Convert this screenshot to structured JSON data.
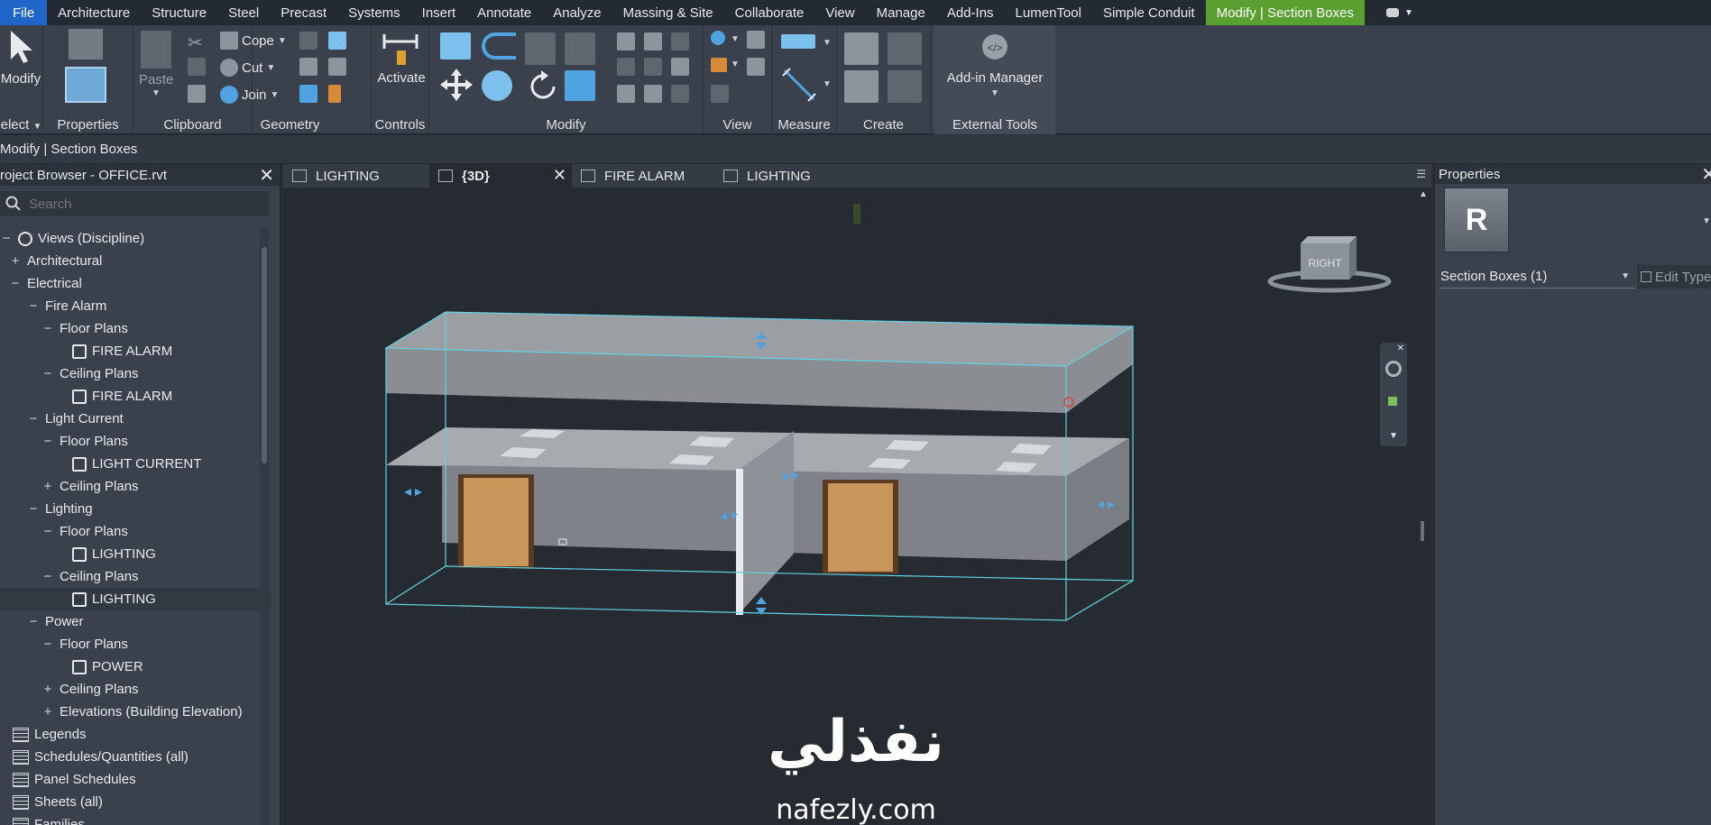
{
  "menu": {
    "items": [
      "File",
      "Architecture",
      "Structure",
      "Steel",
      "Precast",
      "Systems",
      "Insert",
      "Annotate",
      "Analyze",
      "Massing & Site",
      "Collaborate",
      "View",
      "Manage",
      "Add-Ins",
      "LumenTool",
      "Simple Conduit",
      "Modify | Section Boxes"
    ],
    "active_item": "Modify | Section Boxes",
    "accent_color": "#5aa031",
    "file_color": "#1f66c8"
  },
  "ribbon": {
    "modify_label": "Modify",
    "select_label": "elect",
    "properties_label": "Properties",
    "paste_label": "Paste",
    "clipboard_label": "Clipboard",
    "cope_label": "Cope",
    "cut_label": "Cut",
    "join_label": "Join",
    "geometry_label": "Geometry",
    "activate_label": "Activate",
    "controls_label": "Controls",
    "modify_panel_label": "Modify",
    "view_label": "View",
    "measure_label": "Measure",
    "create_label": "Create",
    "addin_manager_label": "Add-in Manager",
    "external_tools_label": "External Tools"
  },
  "context_bar": {
    "text": "Modify | Section Boxes"
  },
  "browser": {
    "title": "roject Browser - OFFICE.rvt",
    "search_placeholder": "Search",
    "tree": [
      {
        "label": "Views (Discipline)",
        "level": 0,
        "toggle": "−",
        "icon": "views-icon"
      },
      {
        "label": "Architectural",
        "level": 1,
        "toggle": "+"
      },
      {
        "label": "Electrical",
        "level": 1,
        "toggle": "−"
      },
      {
        "label": "Fire Alarm",
        "level": 2,
        "toggle": "−"
      },
      {
        "label": "Floor Plans",
        "level": 3,
        "toggle": "−"
      },
      {
        "label": "FIRE ALARM",
        "level": 4,
        "toggle": "",
        "icon": "view"
      },
      {
        "label": "Ceiling Plans",
        "level": 3,
        "toggle": "−"
      },
      {
        "label": "FIRE ALARM",
        "level": 4,
        "toggle": "",
        "icon": "view"
      },
      {
        "label": "Light Current",
        "level": 2,
        "toggle": "−"
      },
      {
        "label": "Floor Plans",
        "level": 3,
        "toggle": "−"
      },
      {
        "label": "LIGHT CURRENT",
        "level": 4,
        "toggle": "",
        "icon": "view"
      },
      {
        "label": "Ceiling Plans",
        "level": 3,
        "toggle": "+"
      },
      {
        "label": "Lighting",
        "level": 2,
        "toggle": "−"
      },
      {
        "label": "Floor Plans",
        "level": 3,
        "toggle": "−"
      },
      {
        "label": "LIGHTING",
        "level": 4,
        "toggle": "",
        "icon": "view"
      },
      {
        "label": "Ceiling Plans",
        "level": 3,
        "toggle": "−"
      },
      {
        "label": "LIGHTING",
        "level": 4,
        "toggle": "",
        "icon": "view",
        "selected": true
      },
      {
        "label": "Power",
        "level": 2,
        "toggle": "−"
      },
      {
        "label": "Floor Plans",
        "level": 3,
        "toggle": "−"
      },
      {
        "label": "POWER",
        "level": 4,
        "toggle": "",
        "icon": "view"
      },
      {
        "label": "Ceiling Plans",
        "level": 3,
        "toggle": "+"
      },
      {
        "label": "Elevations (Building Elevation)",
        "level": 3,
        "toggle": "+"
      },
      {
        "label": "Legends",
        "level": 0,
        "toggle": "",
        "icon": "cat"
      },
      {
        "label": "Schedules/Quantities (all)",
        "level": 0,
        "toggle": "",
        "icon": "cat"
      },
      {
        "label": "Panel Schedules",
        "level": 0,
        "toggle": "",
        "icon": "cat"
      },
      {
        "label": "Sheets (all)",
        "level": 0,
        "toggle": "",
        "icon": "cat"
      },
      {
        "label": "Families",
        "level": 0,
        "toggle": "",
        "icon": "cat"
      }
    ]
  },
  "view_tabs": [
    {
      "label": "LIGHTING",
      "active": false,
      "close": false
    },
    {
      "label": "{3D}",
      "active": true,
      "close": true
    },
    {
      "label": "FIRE ALARM",
      "active": false,
      "close": false
    },
    {
      "label": "LIGHTING",
      "active": false,
      "close": false
    }
  ],
  "viewcube": {
    "face_label": "RIGHT"
  },
  "watermark": {
    "arabic": "نفذلي",
    "url": "nafezly.com"
  },
  "properties": {
    "title": "Properties",
    "type_thumb_letter": "R",
    "type_selector": "Section Boxes (1)",
    "edit_type_label": "Edit Type"
  }
}
